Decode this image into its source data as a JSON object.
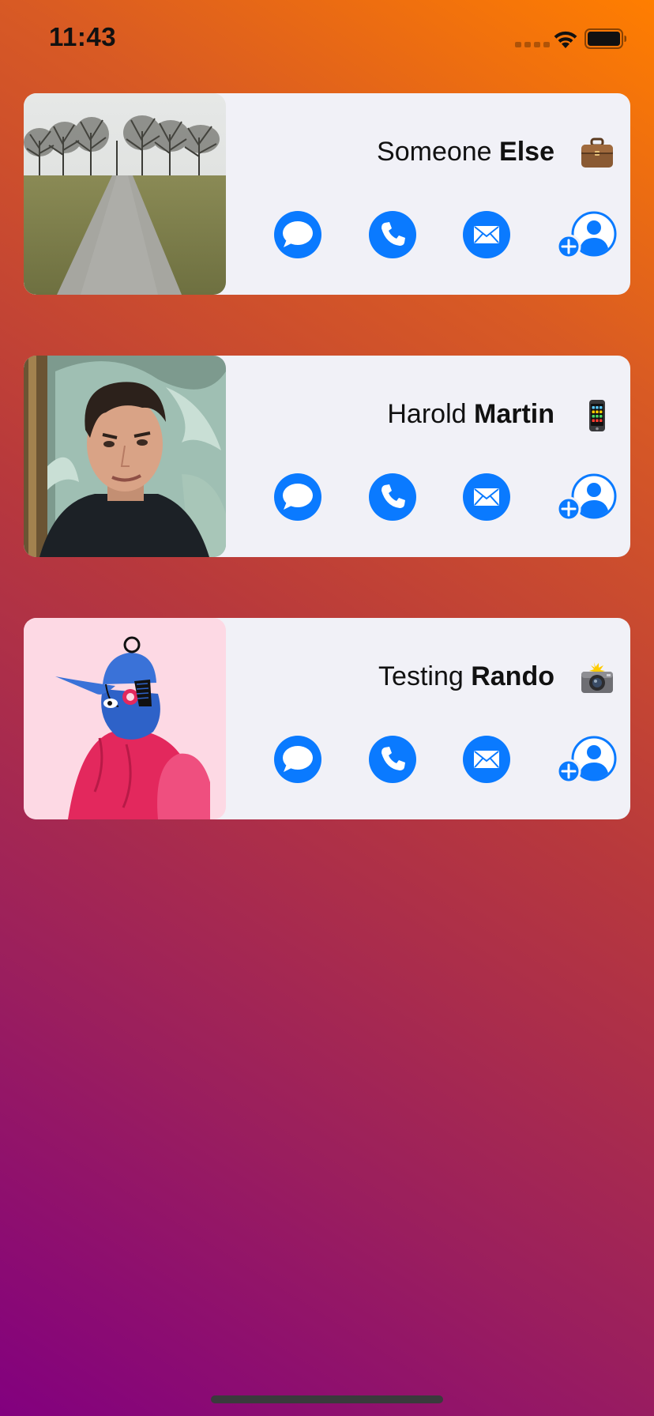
{
  "status_bar": {
    "time": "11:43",
    "icons": [
      "cellular-signal-icon",
      "wifi-icon",
      "battery-icon"
    ]
  },
  "colors": {
    "accent": "#0a7aff",
    "card_background": "#f1f1f7",
    "gradient_start": "#ff7e00",
    "gradient_end": "#82007f"
  },
  "contacts": [
    {
      "first_name": "Someone",
      "last_name": "Else",
      "label_emoji": "briefcase-emoji",
      "photo": "tree-lined-path-photo",
      "actions": [
        "message-icon",
        "phone-icon",
        "mail-icon",
        "add-contact-icon"
      ]
    },
    {
      "first_name": "Harold",
      "last_name": "Martin",
      "label_emoji": "mobile-phone-emoji",
      "photo": "man-portrait-photo",
      "actions": [
        "message-icon",
        "phone-icon",
        "mail-icon",
        "add-contact-icon"
      ]
    },
    {
      "first_name": "Testing",
      "last_name": "Rando",
      "label_emoji": "camera-flash-emoji",
      "photo": "illustrated-character-photo",
      "actions": [
        "message-icon",
        "phone-icon",
        "mail-icon",
        "add-contact-icon"
      ]
    }
  ]
}
